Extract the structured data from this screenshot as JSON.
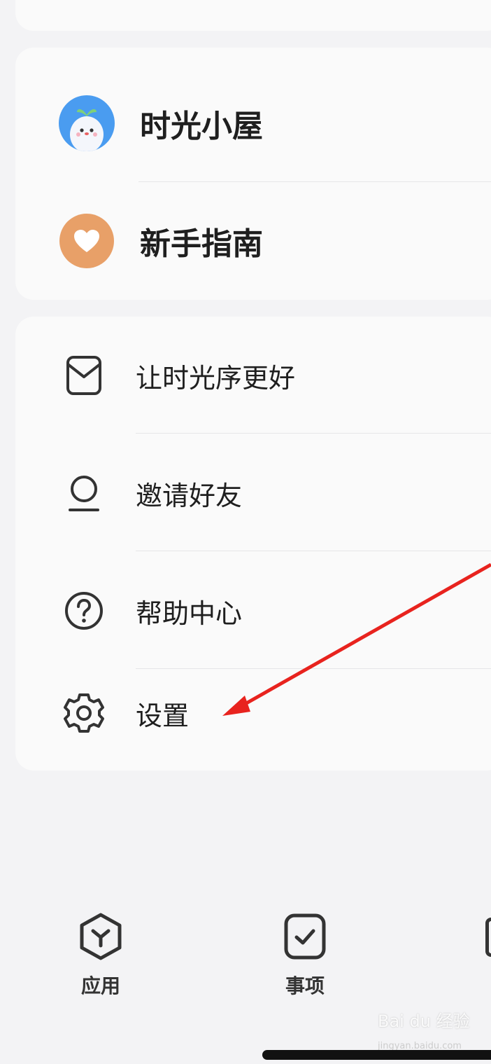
{
  "profile_section": {
    "items": [
      {
        "label": "时光小屋",
        "icon": "mascot-avatar-icon"
      },
      {
        "label": "新手指南",
        "icon": "heart-icon"
      }
    ]
  },
  "menu_section": {
    "items": [
      {
        "label": "让时光序更好",
        "icon": "feedback-envelope-icon"
      },
      {
        "label": "邀请好友",
        "icon": "person-icon"
      },
      {
        "label": "帮助中心",
        "icon": "help-circle-icon"
      },
      {
        "label": "设置",
        "icon": "gear-icon"
      }
    ]
  },
  "bottom_nav": {
    "items": [
      {
        "label": "应用",
        "icon": "apps-hexagon-icon"
      },
      {
        "label": "事项",
        "icon": "task-check-icon"
      }
    ]
  },
  "watermark": {
    "text": "Bai du 经验",
    "sub": "jingyan.baidu.com"
  },
  "colors": {
    "heart_bg": "#e8a068",
    "annotation_arrow": "#e8231e"
  }
}
